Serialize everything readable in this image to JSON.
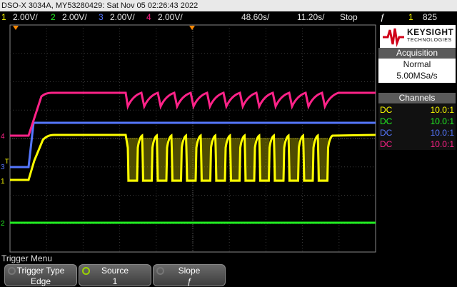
{
  "header": {
    "title": "DSO-X 3034A, MY53280429: Sat Nov 05 02:26:43 2022",
    "ch1": {
      "num": "1",
      "scale": "2.00V/",
      "color": "#ffff00"
    },
    "ch2": {
      "num": "2",
      "scale": "2.00V/",
      "color": "#22ee22"
    },
    "ch3": {
      "num": "3",
      "scale": "2.00V/",
      "color": "#5577ff"
    },
    "ch4": {
      "num": "4",
      "scale": "2.00V/",
      "color": "#ff2288"
    },
    "time_div": "48.60s/",
    "delay": "11.20s/",
    "run_state": "Stop",
    "trigger_symbol": "ƒ",
    "trigger_channel": "1",
    "trigger_level": "825"
  },
  "brand": {
    "name": "KEYSIGHT",
    "sub": "TECHNOLOGIES"
  },
  "acquisition": {
    "title": "Acquisition",
    "mode": "Normal",
    "rate": "5.00MSa/s"
  },
  "channels": {
    "title": "Channels",
    "rows": [
      {
        "coupling": "DC",
        "probe": "10.0:1",
        "color": "#ffff00"
      },
      {
        "coupling": "DC",
        "probe": "10.0:1",
        "color": "#22ee22"
      },
      {
        "coupling": "DC",
        "probe": "10.0:1",
        "color": "#5577ff"
      },
      {
        "coupling": "DC",
        "probe": "10.0:1",
        "color": "#ff2288"
      }
    ]
  },
  "softkeys": {
    "menu_title": "Trigger Menu",
    "trigger_type": {
      "label": "Trigger Type",
      "value": "Edge"
    },
    "source": {
      "label": "Source",
      "value": "1"
    },
    "slope": {
      "label": "Slope",
      "value": "ƒ"
    }
  },
  "markers": {
    "ch1": "1",
    "ch2": "2",
    "ch3": "3",
    "ch4": "4",
    "trig": "T"
  }
}
